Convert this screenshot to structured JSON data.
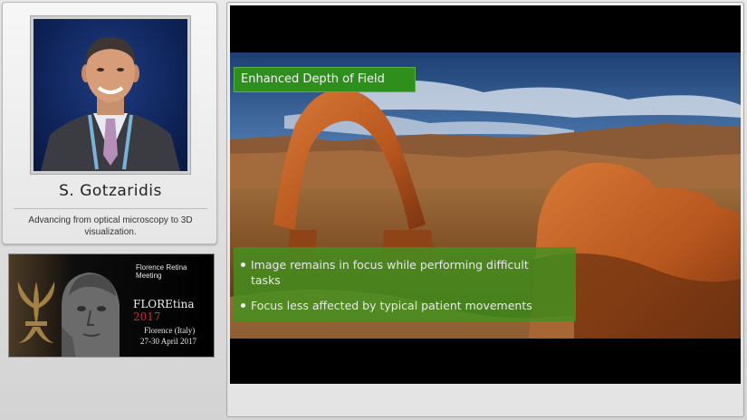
{
  "speaker": {
    "name": "S. Gotzaridis",
    "talk_title": "Advancing from optical microscopy to 3D visualization."
  },
  "event": {
    "name": "Florence Retina Meeting",
    "brand": "FLOREtina",
    "year": "2017",
    "city": "Florence (Italy)",
    "dates": "27-30 April 2017",
    "colors": {
      "year": "#ce2e2e",
      "gold": "#b08a4a"
    }
  },
  "slide": {
    "title": "Enhanced Depth of Field",
    "bullets": [
      {
        "line1": "Image remains in focus while performing difficult",
        "line2": "tasks"
      },
      {
        "line1": "Focus less affected by typical patient movements"
      }
    ],
    "colors": {
      "title_bar": "#2f8f1d",
      "bullet_box": "#42911f"
    }
  }
}
